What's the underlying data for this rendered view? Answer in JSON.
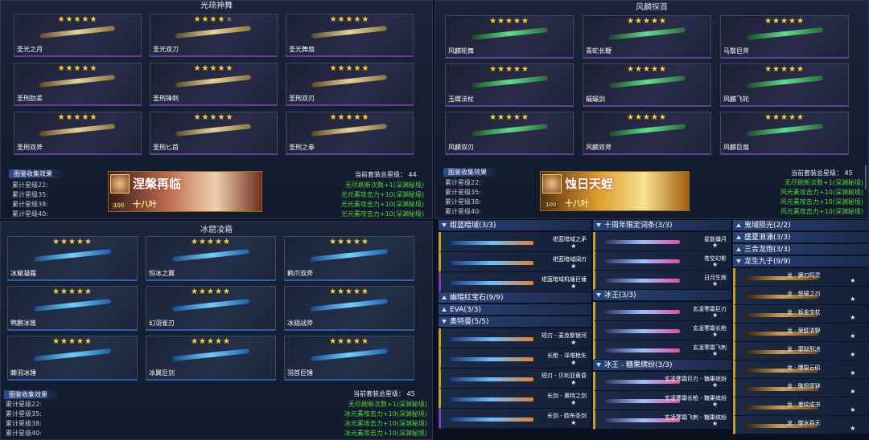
{
  "top_left": {
    "title": "光疏神舞",
    "cards": [
      {
        "name": "圣光之月",
        "stars": "★★★★★",
        "dim": ""
      },
      {
        "name": "圣光双刀",
        "stars": "★★★★",
        "dim": "★"
      },
      {
        "name": "圣光舞扇",
        "stars": "★★★★★",
        "dim": ""
      },
      {
        "name": "圣刑肋差",
        "stars": "★★★★★",
        "dim": ""
      },
      {
        "name": "圣刑锋刺",
        "stars": "★★★★★",
        "dim": ""
      },
      {
        "name": "圣刑双刃",
        "stars": "★★★★★",
        "dim": ""
      },
      {
        "name": "圣刑双斧",
        "stars": "★★★★★",
        "dim": ""
      },
      {
        "name": "圣刑匕首",
        "stars": "★★★★★",
        "dim": ""
      },
      {
        "name": "圣刑之拳",
        "stars": "★★★★★",
        "dim": ""
      }
    ],
    "bonus_label": "图鉴收集效果",
    "total_label": "当前套装总星级：",
    "total_value": "44",
    "banner": {
      "title": "涅槃再临",
      "sub": "十八叶",
      "level": "100"
    },
    "rows": [
      {
        "label": "累计星级22:",
        "value": "无尽刷新次数+1(深渊秘境)"
      },
      {
        "label": "累计星级35:",
        "value": "光元素攻击力+10(深渊秘境)"
      },
      {
        "label": "累计星级38:",
        "value": "光元素攻击力+10(深渊秘境)"
      },
      {
        "label": "累计星级40:",
        "value": "光元素攻击力+10(深渊秘境)"
      }
    ]
  },
  "top_right": {
    "title": "风麟探首",
    "cards": [
      {
        "name": "风麟轮舞",
        "stars": "★★★★★"
      },
      {
        "name": "青蛇长鞭",
        "stars": "★★★★★"
      },
      {
        "name": "马鬃巨斧",
        "stars": "★★★★★"
      },
      {
        "name": "玉蝶法杖",
        "stars": "★★★★★"
      },
      {
        "name": "蝠蝠剑",
        "stars": "★★★★★"
      },
      {
        "name": "风麟飞轮",
        "stars": "★★★★★"
      },
      {
        "name": "风麟双刃",
        "stars": "★★★★★"
      },
      {
        "name": "风麟双斧",
        "stars": "★★★★★"
      },
      {
        "name": "风麟巨扇",
        "stars": "★★★★★"
      }
    ],
    "bonus_label": "图鉴收集效果",
    "total_label": "当前套装总星级：",
    "total_value": "45",
    "banner": {
      "title": "蚀日天蛭",
      "sub": "十八叶",
      "level": "100"
    },
    "rows": [
      {
        "label": "累计星级22:",
        "value": "无尽刷新次数+1(深渊秘境)"
      },
      {
        "label": "累计星级35:",
        "value": "风元素攻击力+10(深渊秘境)"
      },
      {
        "label": "累计星级38:",
        "value": "风元素攻击力+10(深渊秘境)"
      },
      {
        "label": "累计星级40:",
        "value": "风元素攻击力+10(深渊秘境)"
      }
    ]
  },
  "bottom_left": {
    "title": "冰窟凌霜",
    "cards": [
      {
        "name": "冰窟凝霜",
        "stars": "★★★★★"
      },
      {
        "name": "恒冰之翼",
        "stars": "★★★★★"
      },
      {
        "name": "鹤爪双斧",
        "stars": "★★★★★"
      },
      {
        "name": "鸭鹏冰锥",
        "stars": "★★★★★"
      },
      {
        "name": "幻羽雀刃",
        "stars": "★★★★★"
      },
      {
        "name": "冰翅战斧",
        "stars": "★★★★★"
      },
      {
        "name": "棘羽冰锤",
        "stars": "★★★★★"
      },
      {
        "name": "冰翼巨剑",
        "stars": "★★★★★"
      },
      {
        "name": "羽首巨锤",
        "stars": "★★★★★"
      }
    ],
    "bonus_label": "图鉴收集效果",
    "total_label": "当前套装总星级：",
    "total_value": "45",
    "rows": [
      {
        "label": "累计星级22:",
        "value": "无尽刷新次数+1(深渊秘境)"
      },
      {
        "label": "累计星级35:",
        "value": "冰元素攻击力+10(深渊秘境)"
      },
      {
        "label": "累计星级38:",
        "value": "冰元素攻击力+10(深渊秘境)"
      },
      {
        "label": "累计星级40:",
        "value": "冰元素攻击力+10(深渊秘境)"
      }
    ]
  },
  "list1": {
    "groups": [
      {
        "title": "绀蓝暗域(3/3)",
        "items": [
          "绀蓝暗域之矛",
          "绀蓝暗域阔刃",
          "绀蓝暗域机锤巨锤"
        ]
      },
      {
        "title": "幽暗红宝石(9/9)"
      },
      {
        "title": "EVA(3/3)"
      },
      {
        "title": "奥特曼(5/5)",
        "items": [
          "短刃 - 麦克斯银河",
          "长枪 - 泽塔枪矢",
          "短刃 - 贝利亚黄昏",
          "长剑 - 奥特之剑",
          "长剑 - 欧布圣剑"
        ]
      }
    ]
  },
  "list2": {
    "groups": [
      {
        "title": "十周年限定词条(3/3)",
        "items": [
          "星能僵月",
          "苍空幻影",
          "日月生辉"
        ]
      },
      {
        "title": "冰王(3/3)",
        "items": [
          "玄凌寒霜巨刃",
          "玄凌寒霜长枪",
          "玄凌寒霜飞刺"
        ]
      },
      {
        "title": "冰王 - 糖果缤纷(3/3)",
        "items": [
          "玄凌寒霜巨刃 - 糖果缤纷",
          "玄凌寒霜长枪 - 糖果缤纷",
          "玄凌寒霜飞刺 - 糖果缤纷"
        ]
      }
    ]
  },
  "list3": {
    "groups": [
      {
        "title": "鬼域陨光(2/2)"
      },
      {
        "title": "盛夏浪涌(3/3)"
      },
      {
        "title": "三合龙炮(3/3)"
      },
      {
        "title": "龙生九子(9/9)",
        "items": [
          "龙 · 狮刃鸣灵",
          "龙 · 怒啸之刃",
          "龙 · 铄金宝杖",
          "龙 · 荣壁清野",
          "龙 · 罪狱刑决",
          "龙 · 爆裂云矶",
          "龙 · 微担厚钟",
          "龙 · 墨纹成书",
          "龙 · 御水吞天"
        ]
      }
    ]
  },
  "star_single": "★"
}
